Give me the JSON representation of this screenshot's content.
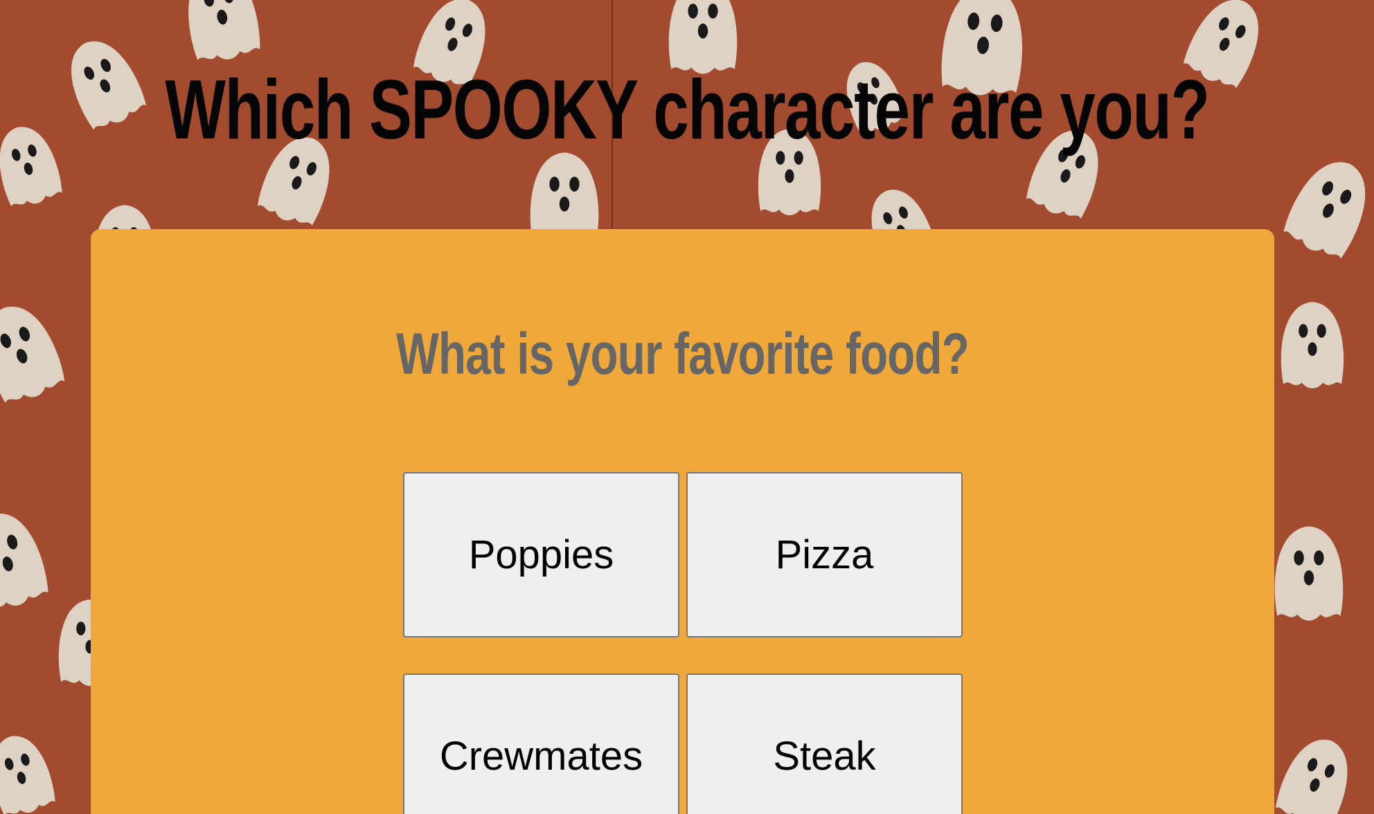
{
  "page": {
    "title": "Which SPOOKY character are you?"
  },
  "quiz": {
    "question": "What is your favorite food?",
    "answers": [
      {
        "label": "Poppies"
      },
      {
        "label": "Pizza"
      },
      {
        "label": "Crewmates"
      },
      {
        "label": "Steak"
      }
    ]
  },
  "colors": {
    "background": "#a24b2f",
    "ghost": "#ded2c4",
    "card": "#f0a83a",
    "question_text": "#666666",
    "button_bg": "#efefef"
  }
}
